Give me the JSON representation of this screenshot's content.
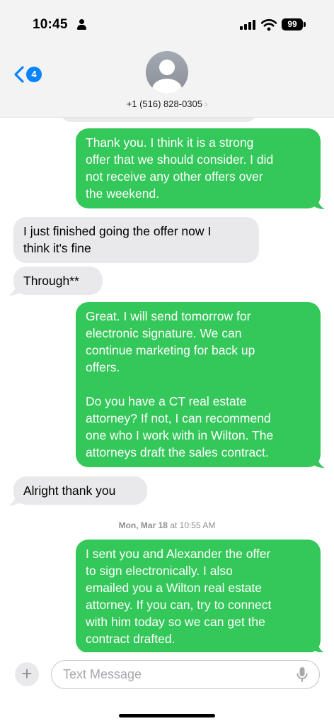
{
  "status_bar": {
    "time": "10:45",
    "battery": "99"
  },
  "header": {
    "back_badge": "4",
    "contact": "+1 (516) 828-0305",
    "contact_chevron": "›"
  },
  "messages": [
    {
      "direction": "out",
      "text": "Thank you. I think it is a strong\noffer that we should consider. I did\nnot receive any other offers over\nthe weekend."
    },
    {
      "direction": "in",
      "text": "I just finished going the offer now I\nthink it's fine"
    },
    {
      "direction": "in",
      "text": "Through**"
    },
    {
      "direction": "out",
      "text": "Great. I will send tomorrow for\nelectronic signature. We can\ncontinue marketing for back up\noffers.\n\nDo you have a CT real estate\nattorney? If not, I can recommend\none who I work with in Wilton. The\nattorneys draft the sales contract."
    },
    {
      "direction": "in",
      "text": "Alright thank you"
    },
    {
      "direction": "out",
      "text": "I sent you and Alexander the offer\nto sign electronically. I also\nemailed you a Wilton real estate\nattorney. If you can, try to connect\nwith him today so we can get the\ncontract drafted."
    }
  ],
  "timestamp": {
    "day": "Mon, Mar 18",
    "at": "at",
    "time": "10:55 AM"
  },
  "compose": {
    "plus": "+",
    "placeholder": "Text Message"
  },
  "icons": [
    "person-icon",
    "signal-icon",
    "wifi-icon",
    "battery-icon",
    "back-chevron-icon",
    "avatar-icon",
    "plus-icon",
    "microphone-icon"
  ],
  "colors": {
    "outgoing_bubble": "#34c759",
    "incoming_bubble": "#e9e9eb",
    "accent": "#0a84ff"
  }
}
